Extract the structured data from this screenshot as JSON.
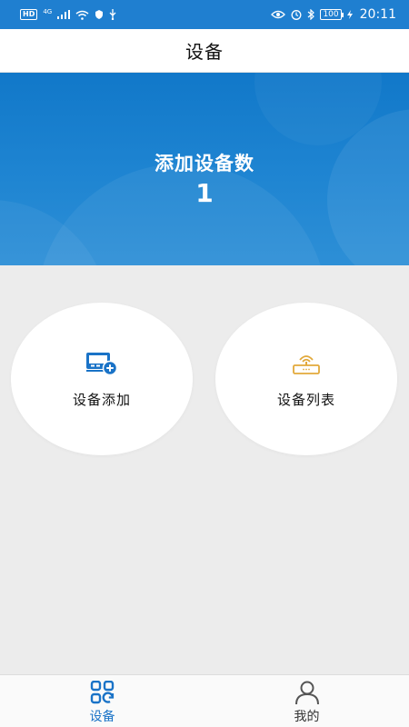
{
  "status_bar": {
    "hd_tag": "HD",
    "network": "4G",
    "battery": "100",
    "time": "20:11"
  },
  "header": {
    "title": "设备"
  },
  "banner": {
    "label": "添加设备数",
    "count": "1"
  },
  "actions": [
    {
      "label": "设备添加",
      "icon": "device-add-icon",
      "color": "#1a73c7"
    },
    {
      "label": "设备列表",
      "icon": "router-icon",
      "color": "#e2a93b"
    }
  ],
  "bottom_nav": {
    "items": [
      {
        "label": "设备",
        "icon": "grid-icon",
        "active": true
      },
      {
        "label": "我的",
        "icon": "user-icon",
        "active": false
      }
    ]
  },
  "colors": {
    "primary": "#1a73c7",
    "banner": "#1f7fd0",
    "accent": "#e2a93b",
    "background": "#ececec"
  }
}
